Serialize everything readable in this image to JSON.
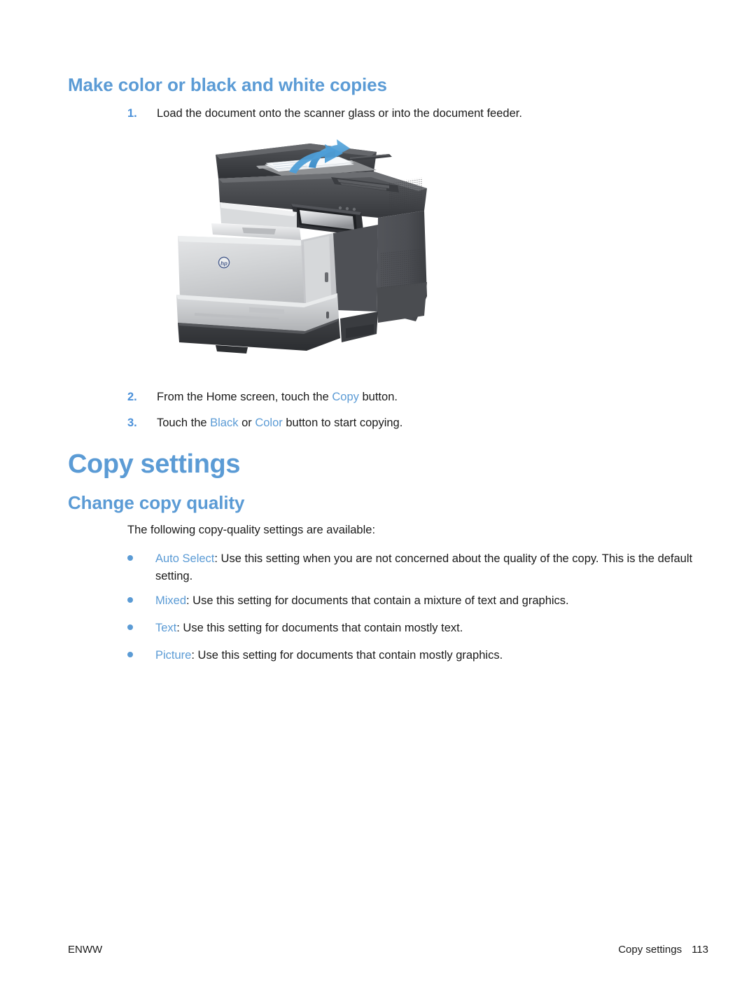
{
  "document": {
    "section_heading": "Make color or black and white copies",
    "chapter_heading": "Copy settings",
    "sub_heading": "Change copy quality"
  },
  "steps": [
    {
      "number": "1.",
      "text_before": "Load the document onto the scanner glass or into the document feeder.",
      "highlight": "",
      "text_after": ""
    },
    {
      "number": "2.",
      "text_before": "From the Home screen, touch the ",
      "highlight": "Copy",
      "text_after": " button."
    },
    {
      "number": "3.",
      "text_before": "Touch the ",
      "highlight": "Black",
      "highlight2": "Color",
      "text_middle": " or ",
      "text_after": " button to start copying."
    }
  ],
  "intro_paragraph": "The following copy-quality settings are available:",
  "bullets": [
    {
      "term": "Auto Select",
      "description": ": Use this setting when you are not concerned about the quality of the copy. This is the default setting."
    },
    {
      "term": "Mixed",
      "description": ": Use this setting for documents that contain a mixture of text and graphics."
    },
    {
      "term": "Text",
      "description": ": Use this setting for documents that contain mostly text."
    },
    {
      "term": "Picture",
      "description": ": Use this setting for documents that contain mostly graphics."
    }
  ],
  "footer": {
    "left": "ENWW",
    "right_label": "Copy settings",
    "page_number": "113"
  },
  "figure": {
    "name": "hp-color-laserjet-mfp-printer",
    "alt": "HP Color LaserJet multifunction printer with document feeder and blue arrow showing paper loading direction",
    "brand_mark": "hp",
    "colors": {
      "accent_blue": "#5b9bd5",
      "arrow_blue": "#4a9ad4",
      "body_dark": "#4b4d50",
      "body_light": "#c9cbcd",
      "top_dark": "#3a3c3f"
    }
  }
}
